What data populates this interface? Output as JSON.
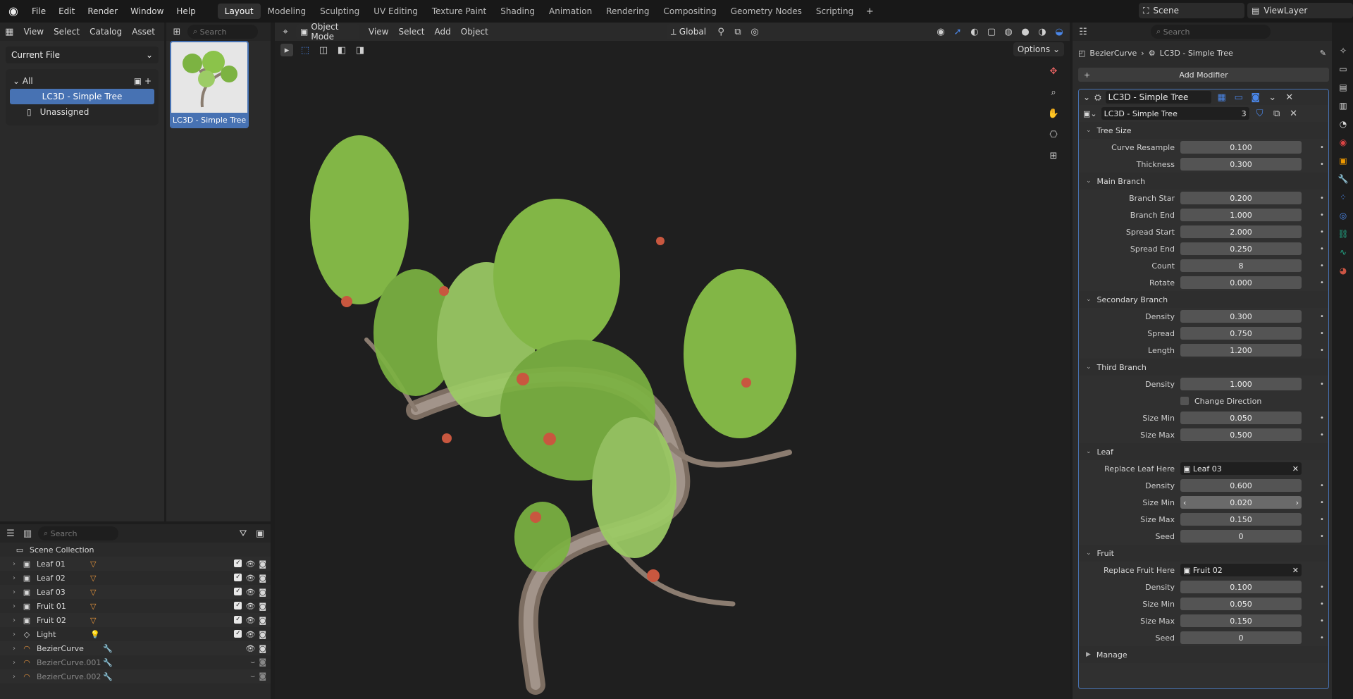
{
  "topbar": {
    "menus": [
      "File",
      "Edit",
      "Render",
      "Window",
      "Help"
    ],
    "workspaces": [
      "Layout",
      "Modeling",
      "Sculpting",
      "UV Editing",
      "Texture Paint",
      "Shading",
      "Animation",
      "Rendering",
      "Compositing",
      "Geometry Nodes",
      "Scripting"
    ],
    "active_workspace": "Layout",
    "plus": "+",
    "scene": "Scene",
    "view_layer": "ViewLayer"
  },
  "asset_browser": {
    "menus": [
      "View",
      "Select",
      "Catalog",
      "Asset"
    ],
    "search_placeholder": "Search",
    "library": "Current File",
    "catalog_root": "All",
    "catalog_selected": "LC3D - Simple Tree",
    "catalog_unassigned": "Unassigned",
    "thumb_label": "LC3D - Simple Tree"
  },
  "viewport": {
    "mode": "Object Mode",
    "menus": [
      "View",
      "Select",
      "Add",
      "Object"
    ],
    "orientation": "Global",
    "options": "Options"
  },
  "outliner": {
    "search_placeholder": "Search",
    "root": "Scene Collection",
    "items": [
      {
        "name": "Leaf 01",
        "badge": "triangle"
      },
      {
        "name": "Leaf 02",
        "badge": "triangle"
      },
      {
        "name": "Leaf 03",
        "badge": "triangle"
      },
      {
        "name": "Fruit 01",
        "badge": "triangle"
      },
      {
        "name": "Fruit 02",
        "badge": "triangle"
      },
      {
        "name": "Light",
        "badge": "bulb"
      },
      {
        "name": "BezierCurve",
        "badge": "wrench"
      },
      {
        "name": "BezierCurve.001",
        "badge": "wrench"
      },
      {
        "name": "BezierCurve.002",
        "badge": "wrench"
      }
    ]
  },
  "properties": {
    "search_placeholder": "Search",
    "breadcrumb_object": "BezierCurve",
    "breadcrumb_modifier": "LC3D - Simple Tree",
    "add_modifier": "Add Modifier",
    "modifier_name": "LC3D - Simple Tree",
    "node_group": "LC3D - Simple Tree",
    "node_users": "3",
    "sections": [
      {
        "title": "Tree Size",
        "rows": [
          {
            "label": "Curve Resample",
            "value": "0.100"
          },
          {
            "label": "Thickness",
            "value": "0.300"
          }
        ]
      },
      {
        "title": "Main Branch",
        "rows": [
          {
            "label": "Branch Star",
            "value": "0.200"
          },
          {
            "label": "Branch End",
            "value": "1.000"
          },
          {
            "label": "Spread Start",
            "value": "2.000"
          },
          {
            "label": "Spread End",
            "value": "0.250"
          },
          {
            "label": "Count",
            "value": "8"
          },
          {
            "label": "Rotate",
            "value": "0.000"
          }
        ]
      },
      {
        "title": "Secondary Branch",
        "rows": [
          {
            "label": "Density",
            "value": "0.300"
          },
          {
            "label": "Spread",
            "value": "0.750"
          },
          {
            "label": "Length",
            "value": "1.200"
          }
        ]
      },
      {
        "title": "Third Branch",
        "rows": [
          {
            "label": "Density",
            "value": "1.000"
          },
          {
            "label": "Change Direction",
            "value": "",
            "checkbox": true
          },
          {
            "label": "Size Min",
            "value": "0.050"
          },
          {
            "label": "Size Max",
            "value": "0.500"
          }
        ]
      },
      {
        "title": "Leaf",
        "rows": [
          {
            "label": "Replace Leaf Here",
            "value": "Leaf 03",
            "object": true
          },
          {
            "label": "Density",
            "value": "0.600"
          },
          {
            "label": "Size Min",
            "value": "0.020",
            "hover": true
          },
          {
            "label": "Size Max",
            "value": "0.150"
          },
          {
            "label": "Seed",
            "value": "0"
          }
        ]
      },
      {
        "title": "Fruit",
        "rows": [
          {
            "label": "Replace Fruit Here",
            "value": "Fruit 02",
            "object": true
          },
          {
            "label": "Density",
            "value": "0.100"
          },
          {
            "label": "Size Min",
            "value": "0.050"
          },
          {
            "label": "Size Max",
            "value": "0.150"
          },
          {
            "label": "Seed",
            "value": "0"
          }
        ]
      }
    ],
    "collapsed_section": "Manage"
  }
}
